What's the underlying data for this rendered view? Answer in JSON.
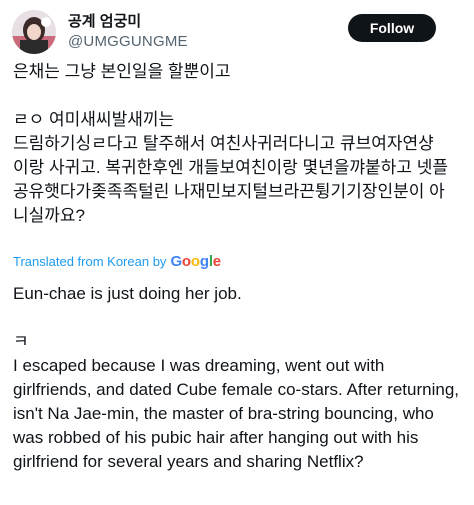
{
  "user": {
    "display_name": "공계 엄궁미",
    "handle": "@UMGGUNGME"
  },
  "follow_button": {
    "label": "Follow"
  },
  "tweet": {
    "line1": "은채는 그냥 본인일을 할뿐이고",
    "line2": "ㄹㅇ 여미새씨발새끼는",
    "line3": "드림하기싱ㄹ다고 탈주해서 여친사귀러다니고 큐브여자연샹",
    "line4": "이랑 사귀고. 복귀한후엔 개들보여친이랑 몇년을꺄붙하고 넷플",
    "line5": "공유햇다가좆족족털린 나재민보지털브라끈튕기기장인분이 아",
    "line6": "니실까요?"
  },
  "translation_note": {
    "prefix": "Translated from Korean by",
    "google": [
      "G",
      "o",
      "o",
      "g",
      "l",
      "e"
    ],
    "google_colors": [
      "#4285F4",
      "#EA4335",
      "#FBBC05",
      "#4285F4",
      "#34A853",
      "#EA4335"
    ]
  },
  "translation": {
    "line1": "Eun-chae is just doing her job.",
    "line2": "ㅋ",
    "line3": "I escaped because I was dreaming, went out with girlfriends, and dated Cube female co-stars. After returning, isn't Na Jae-min, the master of bra-string bouncing, who was robbed of his pubic hair after hanging out with his girlfriend for several years and sharing Netflix?"
  }
}
